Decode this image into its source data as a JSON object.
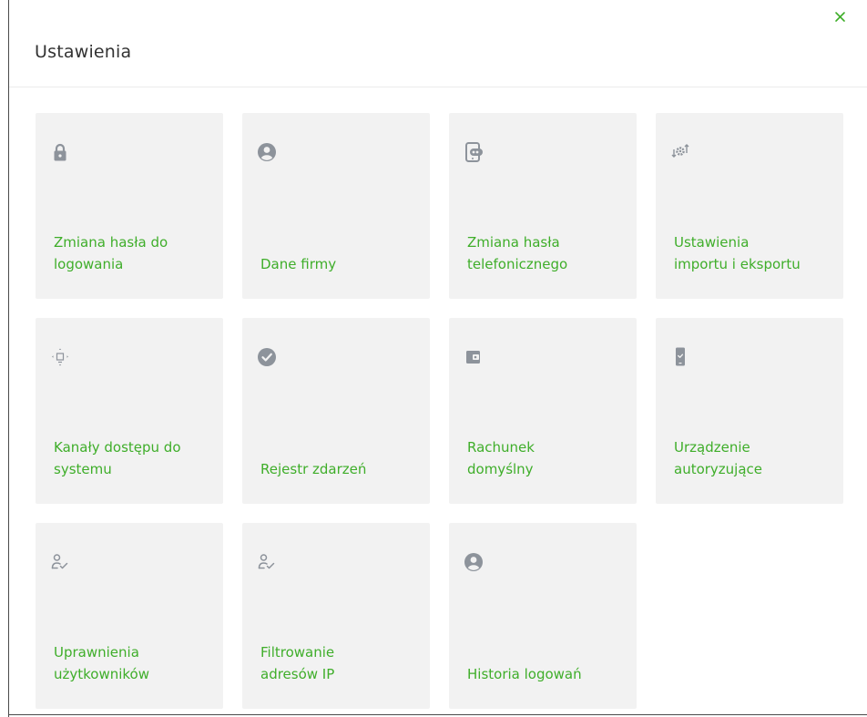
{
  "dialog": {
    "title": "Ustawienia",
    "close_icon": "close-icon",
    "accent_color": "#3fae2a",
    "icon_color": "#8d939b"
  },
  "tiles": [
    {
      "label": "Zmiana hasła do\nlogowania",
      "icon": "lock-icon"
    },
    {
      "label": "Dane firmy",
      "icon": "user-circle-icon"
    },
    {
      "label": "Zmiana hasła\ntelefonicznego",
      "icon": "phone-password-icon"
    },
    {
      "label": "Ustawienia\nimportu i eksportu",
      "icon": "import-export-gear-icon"
    },
    {
      "label": "Kanały dostępu do\nsystemu",
      "icon": "access-channels-icon"
    },
    {
      "label": "Rejestr zdarzeń",
      "icon": "check-circle-icon"
    },
    {
      "label": "Rachunek\ndomyślny",
      "icon": "wallet-icon"
    },
    {
      "label": "Urządzenie\nautoryzujące",
      "icon": "mobile-check-icon"
    },
    {
      "label": "Uprawnienia\nużytkowników",
      "icon": "user-check-icon"
    },
    {
      "label": "Filtrowanie\nadresów IP",
      "icon": "user-check-icon"
    },
    {
      "label": "Historia logowań",
      "icon": "user-circle-icon"
    }
  ]
}
